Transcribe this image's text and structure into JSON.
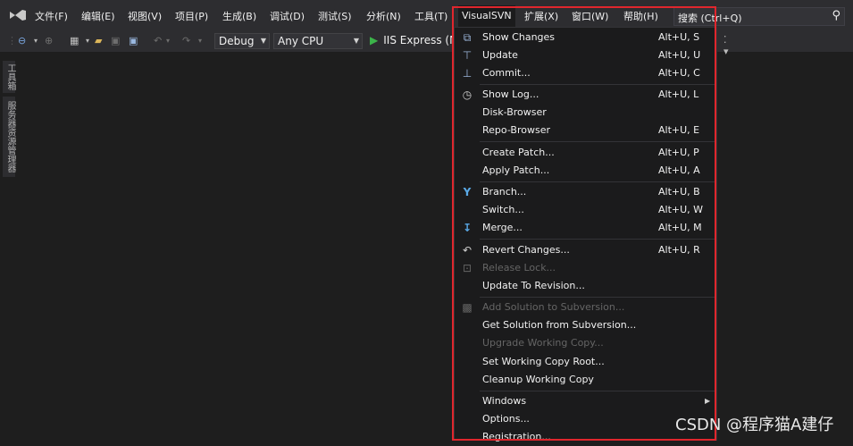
{
  "menubar": {
    "logo_icon": "visual-studio-logo-icon",
    "items": [
      "文件(F)",
      "编辑(E)",
      "视图(V)",
      "项目(P)",
      "生成(B)",
      "调试(D)",
      "测试(S)",
      "分析(N)",
      "工具(T)",
      "VisualSVN",
      "扩展(X)",
      "窗口(W)",
      "帮助(H)"
    ],
    "search_placeholder": "搜索 (Ctrl+Q)"
  },
  "toolbar": {
    "config": "Debug",
    "platform": "Any CPU",
    "run_label": "IIS Express (Mi"
  },
  "side_tabs": [
    "工具箱",
    "服务器资源管理器"
  ],
  "dropdown": {
    "items": [
      {
        "label": "Show Changes",
        "shortcut": "Alt+U, S",
        "icon": "show-changes-icon",
        "enabled": true
      },
      {
        "label": "Update",
        "shortcut": "Alt+U, U",
        "icon": "update-icon",
        "enabled": true
      },
      {
        "label": "Commit...",
        "shortcut": "Alt+U, C",
        "icon": "commit-icon",
        "enabled": true
      },
      {
        "label": "Show Log...",
        "shortcut": "Alt+U, L",
        "icon": "clock-icon",
        "enabled": true
      },
      {
        "label": "Disk-Browser",
        "shortcut": "",
        "icon": "",
        "enabled": true
      },
      {
        "label": "Repo-Browser",
        "shortcut": "Alt+U, E",
        "icon": "",
        "enabled": true
      },
      {
        "label": "Create Patch...",
        "shortcut": "Alt+U, P",
        "icon": "",
        "enabled": true
      },
      {
        "label": "Apply Patch...",
        "shortcut": "Alt+U, A",
        "icon": "",
        "enabled": true
      },
      {
        "label": "Branch...",
        "shortcut": "Alt+U, B",
        "icon": "branch-icon",
        "enabled": true
      },
      {
        "label": "Switch...",
        "shortcut": "Alt+U, W",
        "icon": "",
        "enabled": true
      },
      {
        "label": "Merge...",
        "shortcut": "Alt+U, M",
        "icon": "merge-icon",
        "enabled": true
      },
      {
        "label": "Revert Changes...",
        "shortcut": "Alt+U, R",
        "icon": "revert-icon",
        "enabled": true
      },
      {
        "label": "Release Lock...",
        "shortcut": "",
        "icon": "unlock-icon",
        "enabled": false
      },
      {
        "label": "Update To Revision...",
        "shortcut": "",
        "icon": "",
        "enabled": true
      },
      {
        "label": "Add Solution to Subversion...",
        "shortcut": "",
        "icon": "add-solution-icon",
        "enabled": false
      },
      {
        "label": "Get Solution from Subversion...",
        "shortcut": "",
        "icon": "",
        "enabled": true
      },
      {
        "label": "Upgrade Working Copy...",
        "shortcut": "",
        "icon": "",
        "enabled": false
      },
      {
        "label": "Set Working Copy Root...",
        "shortcut": "",
        "icon": "",
        "enabled": true
      },
      {
        "label": "Cleanup Working Copy",
        "shortcut": "",
        "icon": "",
        "enabled": true
      },
      {
        "label": "Windows",
        "shortcut": "",
        "icon": "",
        "enabled": true,
        "submenu": true
      },
      {
        "label": "Options...",
        "shortcut": "",
        "icon": "",
        "enabled": true
      },
      {
        "label": "Registration...",
        "shortcut": "",
        "icon": "",
        "enabled": true
      }
    ]
  },
  "watermark": "CSDN @程序猫A建仔",
  "colors": {
    "highlight_box": "#e0262d",
    "run_green": "#3cb44a",
    "menu_bg": "#1b1b1c",
    "chrome_bg": "#2d2d30"
  }
}
